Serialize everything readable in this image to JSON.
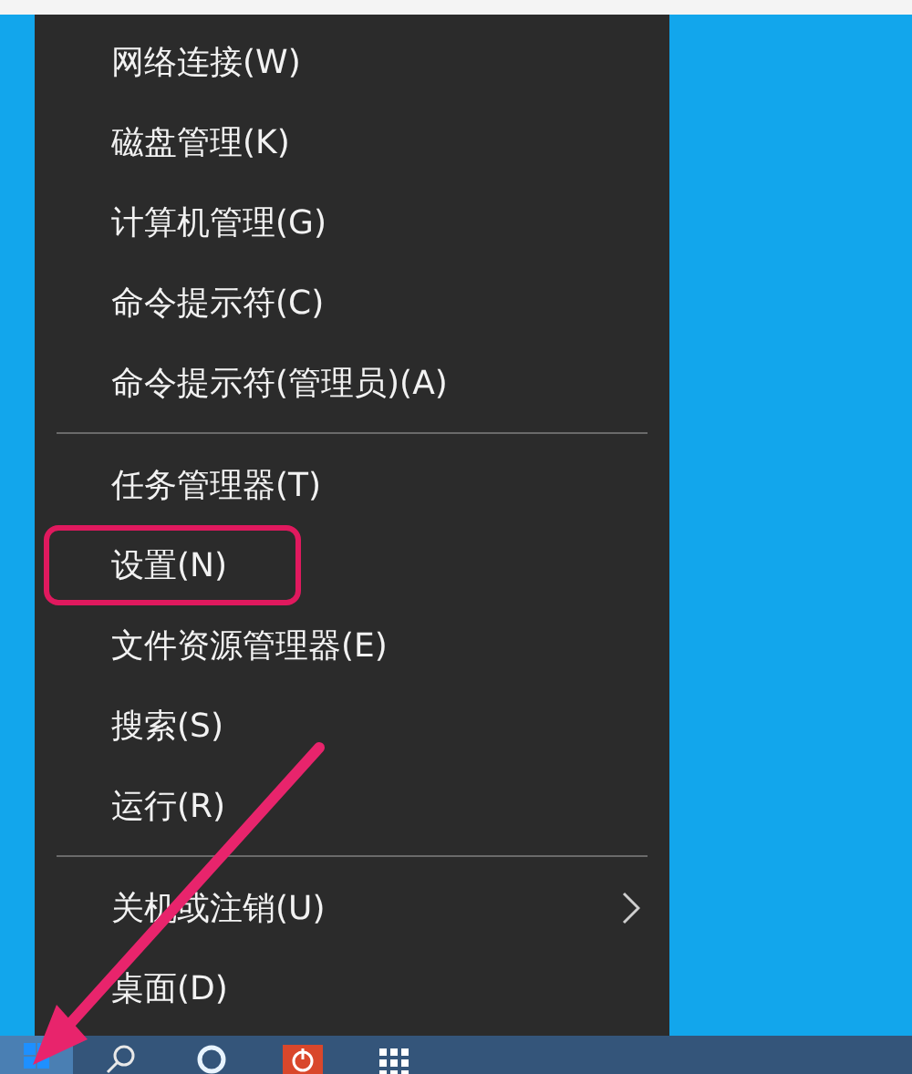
{
  "menu": {
    "groups": [
      {
        "items": [
          {
            "label": "网络连接(W)",
            "highlighted": false,
            "submenu": false
          },
          {
            "label": "磁盘管理(K)",
            "highlighted": false,
            "submenu": false
          },
          {
            "label": "计算机管理(G)",
            "highlighted": false,
            "submenu": false
          },
          {
            "label": "命令提示符(C)",
            "highlighted": false,
            "submenu": false
          },
          {
            "label": "命令提示符(管理员)(A)",
            "highlighted": false,
            "submenu": false
          }
        ]
      },
      {
        "items": [
          {
            "label": "任务管理器(T)",
            "highlighted": false,
            "submenu": false
          },
          {
            "label": "设置(N)",
            "highlighted": true,
            "submenu": false
          },
          {
            "label": "文件资源管理器(E)",
            "highlighted": false,
            "submenu": false
          },
          {
            "label": "搜索(S)",
            "highlighted": false,
            "submenu": false
          },
          {
            "label": "运行(R)",
            "highlighted": false,
            "submenu": false
          }
        ]
      },
      {
        "items": [
          {
            "label": "关机或注销(U)",
            "highlighted": false,
            "submenu": true
          },
          {
            "label": "桌面(D)",
            "highlighted": false,
            "submenu": false
          }
        ]
      }
    ]
  },
  "taskbar": {
    "items": [
      {
        "kind": "start",
        "selected": true
      },
      {
        "kind": "search",
        "selected": false
      },
      {
        "kind": "cortana",
        "selected": false
      },
      {
        "kind": "app",
        "selected": false
      },
      {
        "kind": "apps",
        "selected": false
      }
    ]
  },
  "annotation": {
    "arrow": true
  }
}
